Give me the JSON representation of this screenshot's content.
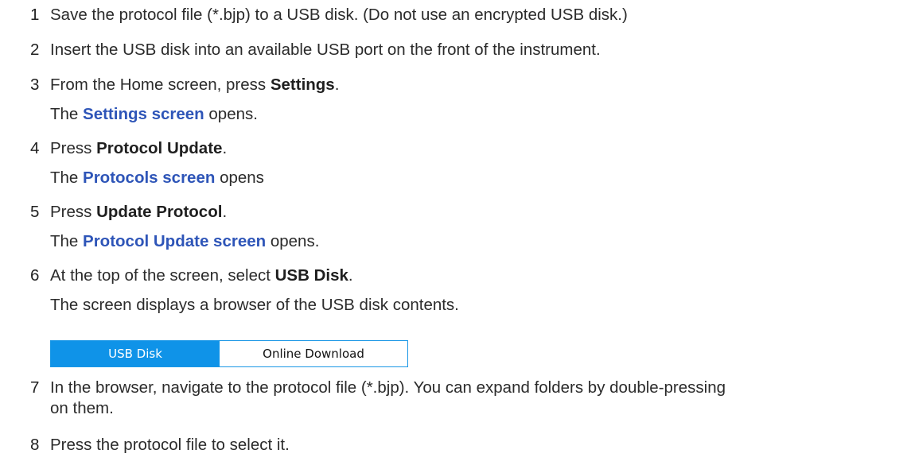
{
  "steps": [
    {
      "num": "1",
      "text": "Save the protocol file (*.bjp) to a USB disk. (Do not use an encrypted USB disk.)"
    },
    {
      "num": "2",
      "text": "Insert the USB disk into an available USB port on the front of the instrument."
    },
    {
      "num": "3",
      "pre": "From the Home screen, press ",
      "bold": "Settings",
      "post": ".",
      "result_pre": "The ",
      "result_link": "Settings screen",
      "result_post": " opens."
    },
    {
      "num": "4",
      "pre": "Press ",
      "bold": "Protocol Update",
      "post": ".",
      "result_pre": "The ",
      "result_link": "Protocols screen",
      "result_post": " opens"
    },
    {
      "num": "5",
      "pre": "Press ",
      "bold": "Update Protocol",
      "post": ".",
      "result_pre": "The ",
      "result_link": "Protocol Update screen",
      "result_post": " opens."
    },
    {
      "num": "6",
      "pre": "At the top of the screen, select ",
      "bold": "USB Disk",
      "post": ".",
      "result": "The screen displays a browser of the USB disk contents."
    },
    {
      "num": "7",
      "text_line1": "In the browser, navigate to the protocol file (*.bjp). You can expand folders by double-pressing",
      "text_line2": "on them."
    },
    {
      "num": "8",
      "text": "Press the protocol file to select it."
    }
  ],
  "tabs": {
    "usb_label": "USB Disk",
    "online_label": "Online Download",
    "active_color": "#0f93e8"
  }
}
